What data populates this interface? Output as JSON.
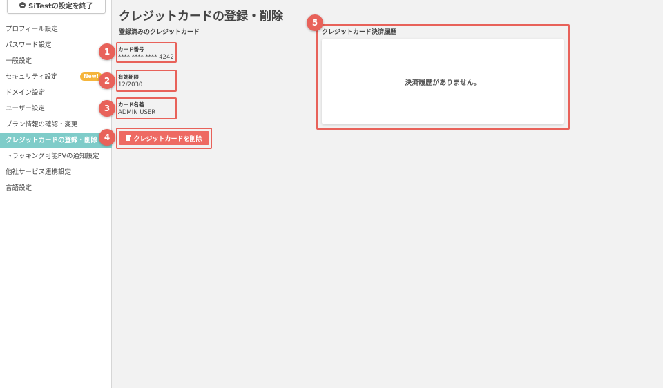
{
  "colors": {
    "accent": "#7fccc9",
    "highlight": "#e8625a",
    "delete": "#ee6a63",
    "badge": "#f5b53c"
  },
  "sidebar": {
    "exit_label": "SiTestの設定を終了",
    "exit_icon": "minus-circle-icon",
    "items": [
      {
        "label": "プロフィール設定"
      },
      {
        "label": "パスワード設定"
      },
      {
        "label": "一般設定"
      },
      {
        "label": "セキュリティ設定",
        "badge": "New!"
      },
      {
        "label": "ドメイン設定"
      },
      {
        "label": "ユーザー設定"
      },
      {
        "label": "プラン情報の確認・変更"
      },
      {
        "label": "クレジットカードの登録・削除",
        "active": true
      },
      {
        "label": "トラッキング可能PVの通知設定"
      },
      {
        "label": "他社サービス連携設定"
      },
      {
        "label": "言語設定"
      }
    ]
  },
  "main": {
    "title": "クレジットカードの登録・削除",
    "registered_label": "登録済みのクレジットカード",
    "card_number": {
      "label": "カード番号",
      "value": "**** **** **** 4242"
    },
    "expiry": {
      "label": "有効期限",
      "value": "12/2030"
    },
    "holder": {
      "label": "カード名義",
      "value": "ADMIN USER"
    },
    "delete_label": "クレジットカードを削除",
    "delete_icon": "trash-icon",
    "history": {
      "label": "クレジットカード決済履歴",
      "empty_text": "決済履歴がありません。"
    }
  },
  "markers": [
    "1",
    "2",
    "3",
    "4",
    "5"
  ]
}
